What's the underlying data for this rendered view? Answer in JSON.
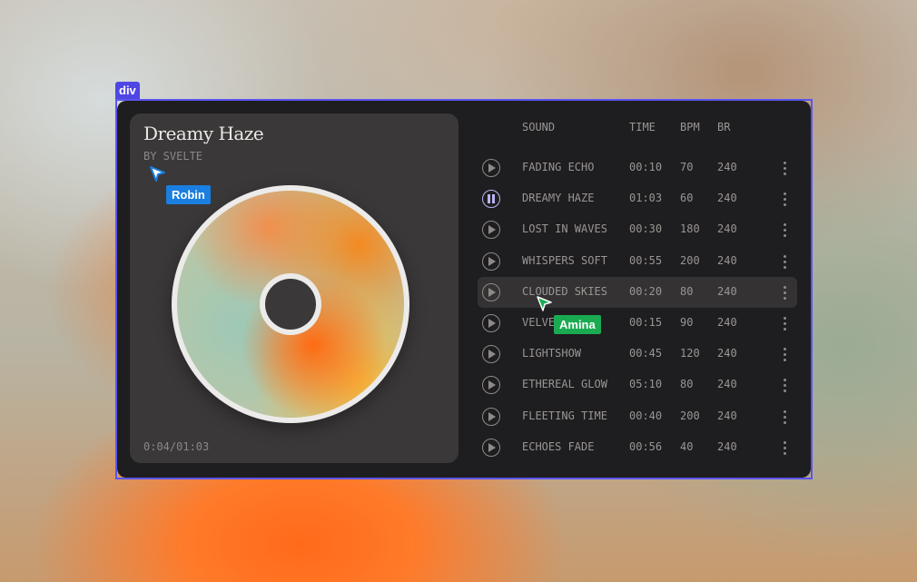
{
  "selection_label": "div",
  "track": {
    "title": "Dreamy Haze",
    "artist": "BY SVELTE",
    "progress": "0:04/01:03"
  },
  "columns": {
    "sound": "SOUND",
    "time": "TIME",
    "bpm": "BPM",
    "br": "BR"
  },
  "rows": [
    {
      "name": "FADING ECHO",
      "time": "00:10",
      "bpm": "70",
      "br": "240",
      "state": "play"
    },
    {
      "name": "DREAMY HAZE",
      "time": "01:03",
      "bpm": "60",
      "br": "240",
      "state": "pause"
    },
    {
      "name": "LOST IN WAVES",
      "time": "00:30",
      "bpm": "180",
      "br": "240",
      "state": "play"
    },
    {
      "name": "WHISPERS SOFT",
      "time": "00:55",
      "bpm": "200",
      "br": "240",
      "state": "play"
    },
    {
      "name": "CLOUDED SKIES",
      "time": "00:20",
      "bpm": "80",
      "br": "240",
      "state": "play"
    },
    {
      "name": "VELVET",
      "time": "00:15",
      "bpm": "90",
      "br": "240",
      "state": "play"
    },
    {
      "name": "LIGHTSHOW",
      "time": "00:45",
      "bpm": "120",
      "br": "240",
      "state": "play"
    },
    {
      "name": "ETHEREAL GLOW",
      "time": "05:10",
      "bpm": "80",
      "br": "240",
      "state": "play"
    },
    {
      "name": "FLEETING TIME",
      "time": "00:40",
      "bpm": "200",
      "br": "240",
      "state": "play"
    },
    {
      "name": "ECHOES FADE",
      "time": "00:56",
      "bpm": "40",
      "br": "240",
      "state": "play"
    }
  ],
  "collaborators": [
    {
      "name": "Robin",
      "color": "#1a7fe0"
    },
    {
      "name": "Amina",
      "color": "#1aab52"
    }
  ],
  "colors": {
    "accent": "#5b55f0",
    "panel": "#1e1d1f",
    "card": "#3a3839"
  }
}
